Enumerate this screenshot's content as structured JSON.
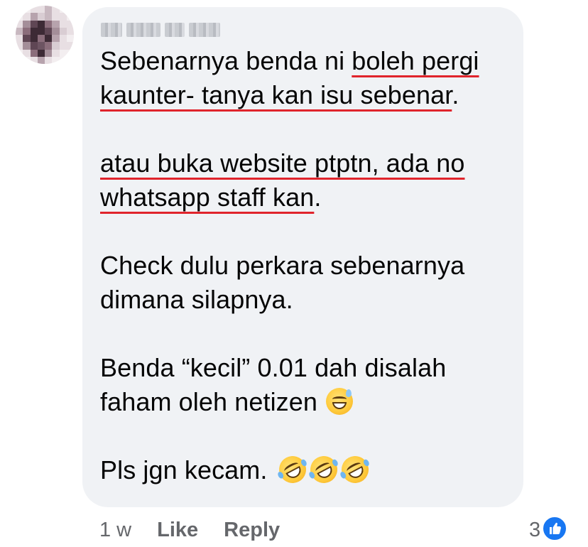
{
  "comment": {
    "author_name": "",
    "paragraphs": [
      {
        "parts": [
          {
            "text": "Sebenarnya benda ni ",
            "underline": false
          },
          {
            "text": "boleh pergi kaunter- tanya kan isu sebenar",
            "underline": true
          },
          {
            "text": ".",
            "underline": false
          }
        ]
      },
      {
        "parts": [
          {
            "text": "atau buka website ptptn, ada no whatsapp staff kan",
            "underline": true
          },
          {
            "text": ".",
            "underline": false
          }
        ]
      },
      {
        "parts": [
          {
            "text": "Check dulu perkara sebenarnya dimana silapnya.",
            "underline": false
          }
        ]
      },
      {
        "parts": [
          {
            "text": "Benda “kecil” 0.01 dah disalah faham oleh netizen ",
            "underline": false
          }
        ],
        "emojis": [
          "grinning-sweat-emoji"
        ]
      },
      {
        "parts": [
          {
            "text": "Pls jgn kecam. ",
            "underline": false
          }
        ],
        "emojis": [
          "rolling-on-floor-laughing-emoji",
          "rolling-on-floor-laughing-emoji",
          "rolling-on-floor-laughing-emoji"
        ]
      }
    ],
    "underline_color": "#e0242c"
  },
  "actions": {
    "time": "1 w",
    "like_label": "Like",
    "reply_label": "Reply"
  },
  "reactions": {
    "count": "3",
    "icon": "thumbs-up-icon",
    "icon_color": "#1877f2"
  },
  "colors": {
    "bubble": "#f0f2f5",
    "text": "#050505",
    "secondary_text": "#65676b"
  }
}
